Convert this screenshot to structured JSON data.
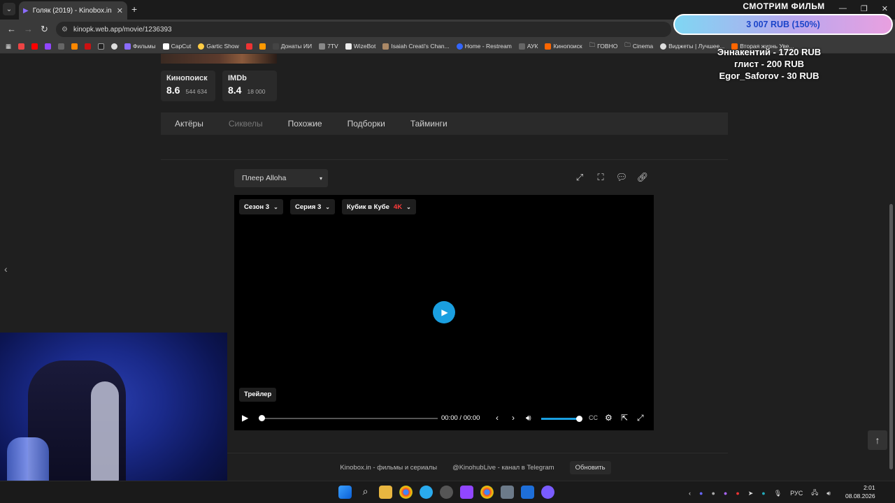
{
  "browser": {
    "tab_title": "Голяк (2019) - Kinobox.in",
    "url": "kinopk.web.app/movie/1236393",
    "bookmarks": [
      "Фильмы",
      "CapCut",
      "Gartic Show",
      "Донаты ИИ",
      "7TV",
      "WizeBot",
      "Isaiah Creati's Chan...",
      "Home - Restream",
      "АУК",
      "Кинопоиск",
      "ГОВНО",
      "Cinema",
      "Виджеты | Лучшее...",
      "Вторая жизнь Уве..."
    ]
  },
  "ratings": [
    {
      "source": "Кинопоиск",
      "value": "8.6",
      "count": "544 634"
    },
    {
      "source": "IMDb",
      "value": "8.4",
      "count": "18 000"
    }
  ],
  "tabs": [
    {
      "label": "Актёры",
      "dim": false
    },
    {
      "label": "Сиквелы",
      "dim": true
    },
    {
      "label": "Похожие",
      "dim": false
    },
    {
      "label": "Подборки",
      "dim": false
    },
    {
      "label": "Тайминги",
      "dim": false
    }
  ],
  "player": {
    "select_label": "Плеер Alloha",
    "season": "Сезон 3",
    "episode": "Серия 3",
    "dub": "Кубик в Кубе",
    "quality_badge": "4K",
    "trailer": "Трейлер",
    "time": "00:00 / 00:00",
    "progress": 0,
    "volume": 1
  },
  "footer": {
    "site": "Kinobox.in - фильмы и сериалы",
    "telegram": "@KinohubLive - канал в Telegram",
    "refresh": "Обновить"
  },
  "stream": {
    "title": "СМОТРИМ ФИЛЬМ",
    "goal": "3 007 RUB (150%)",
    "donors": [
      "Эннакентий - 1720 RUB",
      "глист - 200 RUB",
      "Egor_Saforov - 30 RUB"
    ]
  },
  "taskbar": {
    "lang": "РУС",
    "time": "2:01",
    "date": "08.08.2026"
  }
}
